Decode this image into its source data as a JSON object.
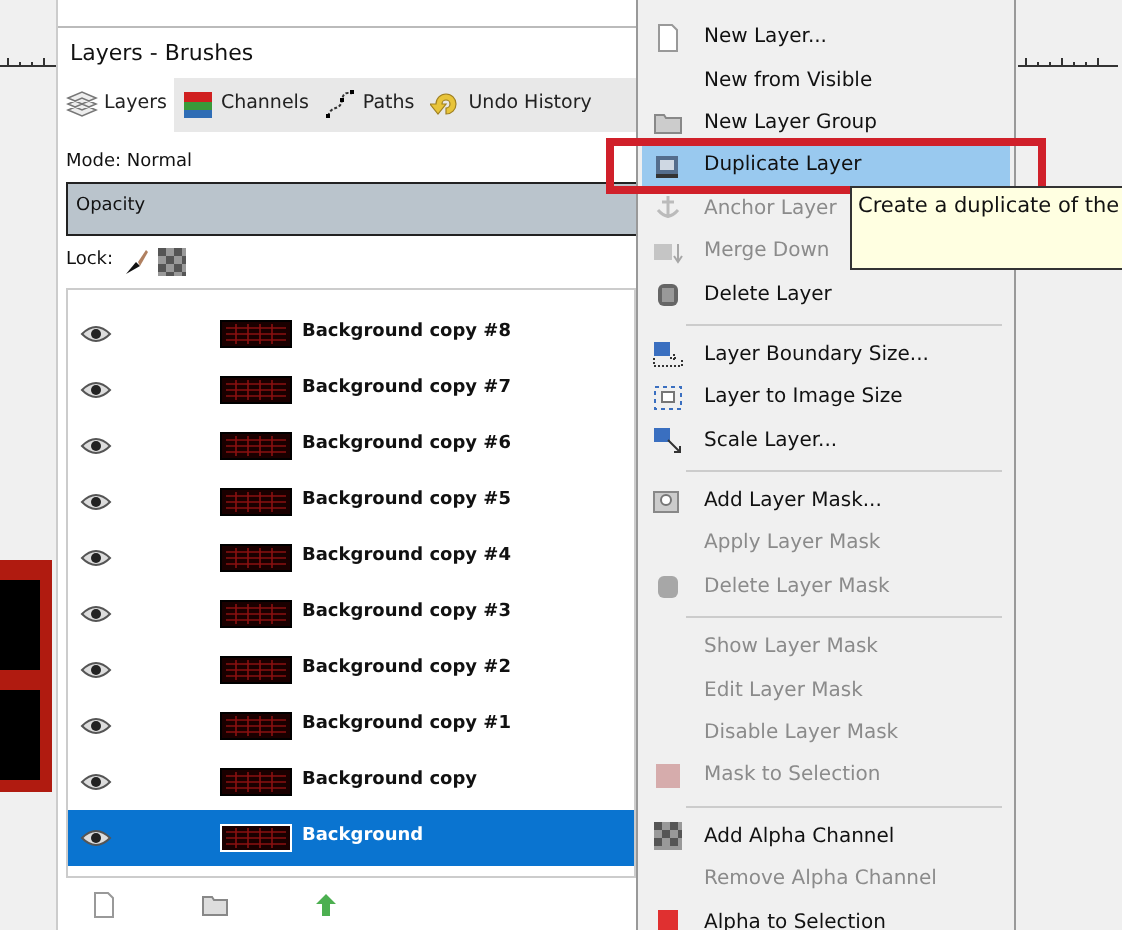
{
  "panel": {
    "title": "Layers - Brushes",
    "tabs": [
      {
        "label": "Layers",
        "selected": true
      },
      {
        "label": "Channels",
        "selected": false
      },
      {
        "label": "Paths",
        "selected": false
      },
      {
        "label": "Undo History",
        "selected": false
      }
    ],
    "mode": "Mode: Normal",
    "opacity": {
      "label": "Opacity",
      "level": 1
    },
    "lock": "Lock:",
    "layers": [
      {
        "name": "Background copy #8",
        "visible": true,
        "selected": false
      },
      {
        "name": "Background copy #7",
        "visible": true,
        "selected": false
      },
      {
        "name": "Background copy #6",
        "visible": true,
        "selected": false
      },
      {
        "name": "Background copy #5",
        "visible": true,
        "selected": false
      },
      {
        "name": "Background copy #4",
        "visible": true,
        "selected": false
      },
      {
        "name": "Background copy #3",
        "visible": true,
        "selected": false
      },
      {
        "name": "Background copy #2",
        "visible": true,
        "selected": false
      },
      {
        "name": "Background copy #1",
        "visible": true,
        "selected": false
      },
      {
        "name": "Background copy",
        "visible": true,
        "selected": false
      },
      {
        "name": "Background",
        "visible": true,
        "selected": true
      }
    ]
  },
  "menu": {
    "items": [
      {
        "label": "New Layer...",
        "disabled": false,
        "selected": false
      },
      {
        "label": "New from Visible",
        "disabled": false,
        "selected": false
      },
      {
        "label": "New Layer Group",
        "disabled": false,
        "selected": false
      },
      {
        "label": "Duplicate Layer",
        "disabled": false,
        "selected": true
      },
      {
        "label": "Anchor Layer",
        "disabled": true,
        "selected": false
      },
      {
        "label": "Merge Down",
        "disabled": true,
        "selected": false
      },
      {
        "label": "Delete Layer",
        "disabled": false,
        "selected": false,
        "separator_after": true
      },
      {
        "label": "Layer Boundary Size...",
        "disabled": false,
        "selected": false
      },
      {
        "label": "Layer to Image Size",
        "disabled": false,
        "selected": false
      },
      {
        "label": "Scale Layer...",
        "disabled": false,
        "selected": false,
        "separator_after": true
      },
      {
        "label": "Add Layer Mask...",
        "disabled": false,
        "selected": false
      },
      {
        "label": "Apply Layer Mask",
        "disabled": true,
        "selected": false
      },
      {
        "label": "Delete Layer Mask",
        "disabled": true,
        "selected": false,
        "separator_after": true
      },
      {
        "label": "Show Layer Mask",
        "disabled": true,
        "selected": false
      },
      {
        "label": "Edit Layer Mask",
        "disabled": true,
        "selected": false
      },
      {
        "label": "Disable Layer Mask",
        "disabled": true,
        "selected": false
      },
      {
        "label": "Mask to Selection",
        "disabled": true,
        "selected": false,
        "separator_after": true
      },
      {
        "label": "Add Alpha Channel",
        "disabled": false,
        "selected": false
      },
      {
        "label": "Remove Alpha Channel",
        "disabled": true,
        "selected": false
      },
      {
        "label": "Alpha to Selection",
        "disabled": false,
        "selected": false
      }
    ]
  },
  "tooltip": "Create a duplicate of the"
}
